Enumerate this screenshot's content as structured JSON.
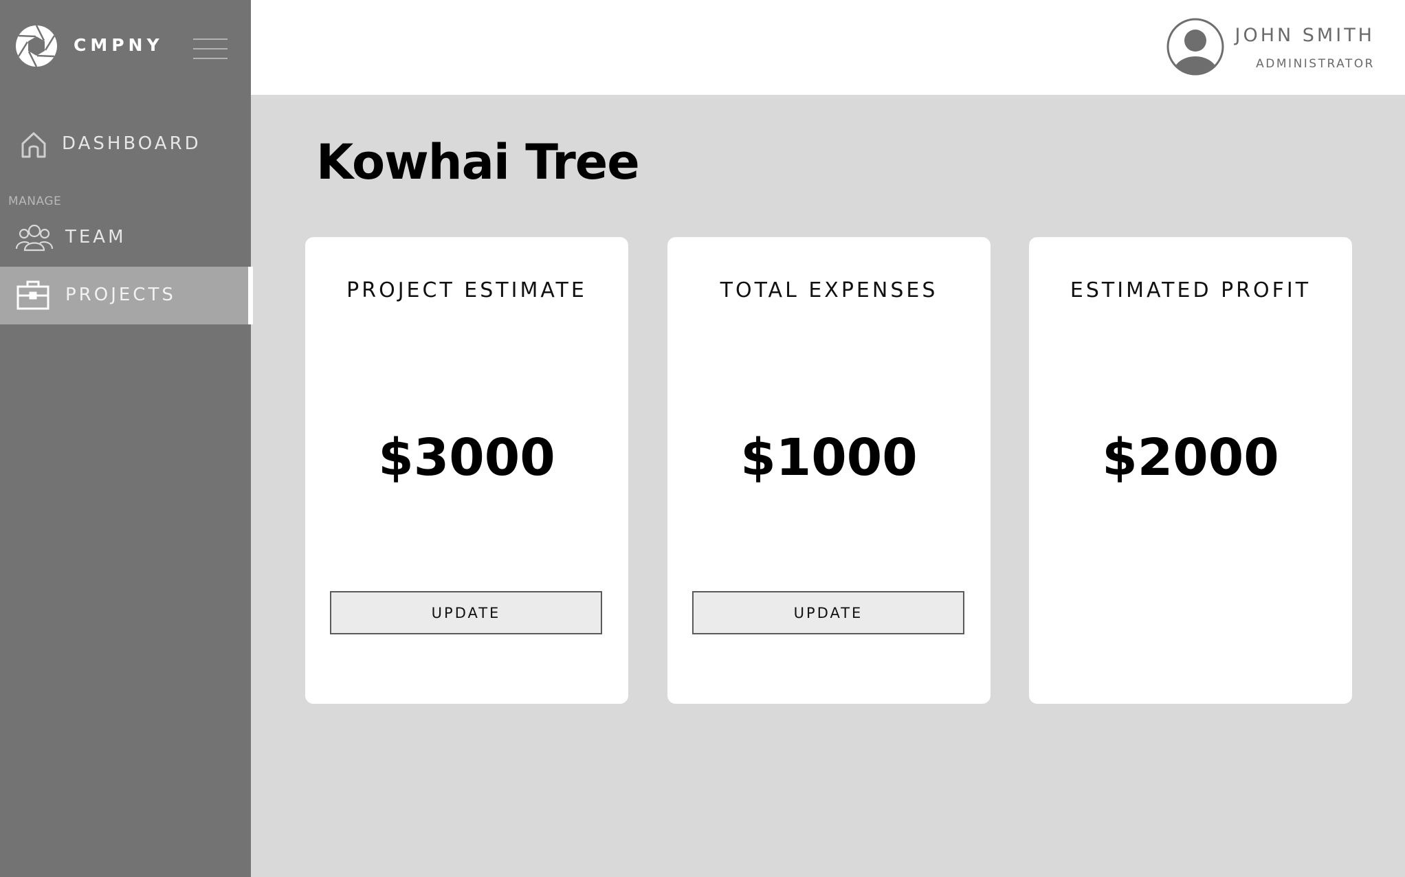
{
  "sidebar": {
    "brand": "CMPNY",
    "section_label": "MANAGE",
    "items": [
      {
        "label": "DASHBOARD",
        "icon": "home-icon"
      },
      {
        "label": "TEAM",
        "icon": "team-icon"
      },
      {
        "label": "PROJECTS",
        "icon": "briefcase-icon",
        "active": true
      }
    ]
  },
  "header": {
    "user_name": "JOHN SMITH",
    "user_role": "ADMINISTRATOR"
  },
  "main": {
    "title": "Kowhai Tree",
    "cards": [
      {
        "title": "PROJECT ESTIMATE",
        "value": "$3000",
        "button": "UPDATE"
      },
      {
        "title": "TOTAL EXPENSES",
        "value": "$1000",
        "button": "UPDATE"
      },
      {
        "title": "ESTIMATED PROFIT",
        "value": "$2000"
      }
    ]
  },
  "colors": {
    "sidebar_bg": "#737373",
    "active_item_bg": "#a6a6a6",
    "content_bg": "#d9d9d9",
    "card_bg": "#ffffff"
  }
}
